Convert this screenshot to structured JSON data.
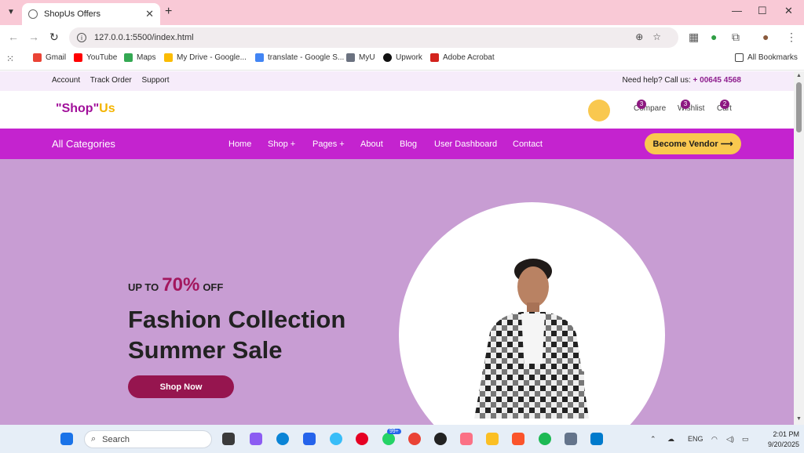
{
  "browser": {
    "tab_title": "ShopUs Offers",
    "url": "127.0.0.1:5500/index.html",
    "bookmarks": [
      "Gmail",
      "YouTube",
      "Maps",
      "My Drive - Google...",
      "translate - Google S...",
      "MyU",
      "Upwork",
      "Adobe Acrobat"
    ],
    "all_bookmarks": "All Bookmarks"
  },
  "site": {
    "top_links": [
      "Account",
      "Track Order",
      "Support"
    ],
    "help_text": "Need help? Call us: ",
    "help_phone": "+ 00645 4568",
    "logo_main": "\"Shop\"",
    "logo_accent": "Us",
    "header_items": [
      {
        "label": "Compare",
        "count": "3"
      },
      {
        "label": "Wishlist",
        "count": "3"
      },
      {
        "label": "Cart",
        "count": "2"
      }
    ],
    "all_categories": "All Categories",
    "menu": [
      "Home",
      "Shop +",
      "Pages +",
      "About",
      "Blog",
      "User Dashboard",
      "Contact"
    ],
    "vendor_button": "Become Vendor ⟶",
    "hero": {
      "upto_prefix": "UP TO",
      "upto_percent": "70%",
      "upto_suffix": "OFF",
      "title_line1": "Fashion Collection",
      "title_line2": "Summer Sale",
      "shop_button": "Shop Now"
    }
  },
  "taskbar": {
    "search_placeholder": "Search",
    "lang": "ENG",
    "badge": "99+",
    "time": "2:01 PM",
    "date": "9/20/2025"
  },
  "colors": {
    "menu_bg": "#c423cf",
    "hero_bg": "#c89dd3",
    "accent_yellow": "#f9c84f",
    "shop_button": "#96154f"
  }
}
